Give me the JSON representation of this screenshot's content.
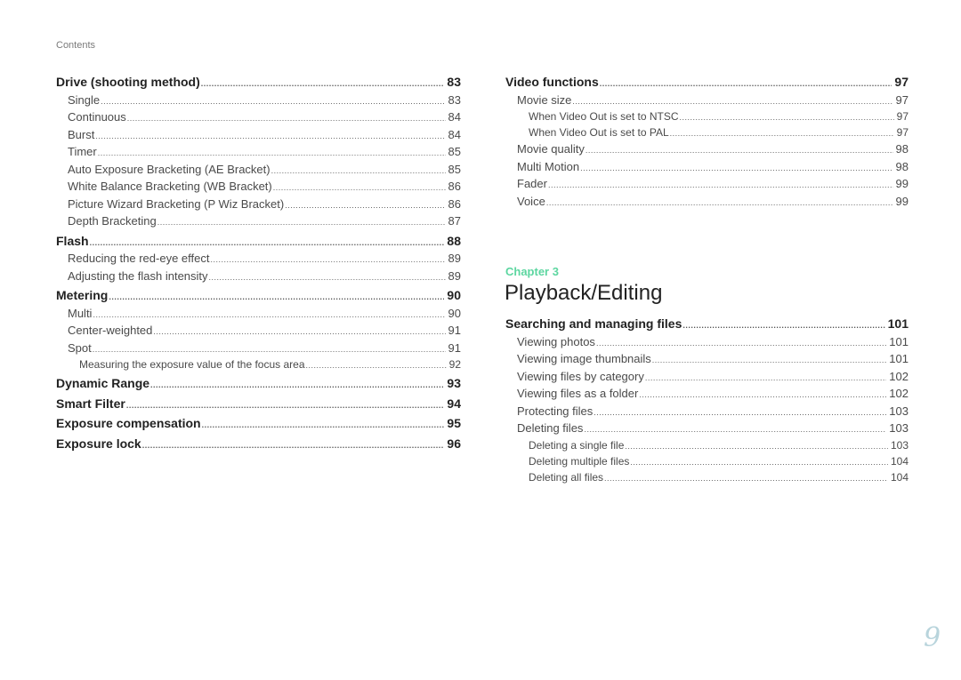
{
  "header": {
    "label": "Contents"
  },
  "left_column": [
    {
      "level": 0,
      "title": "Drive (shooting method)",
      "page": "83"
    },
    {
      "level": 1,
      "title": "Single",
      "page": "83"
    },
    {
      "level": 1,
      "title": "Continuous",
      "page": "84"
    },
    {
      "level": 1,
      "title": "Burst",
      "page": "84"
    },
    {
      "level": 1,
      "title": "Timer",
      "page": "85"
    },
    {
      "level": 1,
      "title": "Auto Exposure Bracketing (AE Bracket)",
      "page": "85"
    },
    {
      "level": 1,
      "title": "White Balance Bracketing (WB Bracket)",
      "page": "86"
    },
    {
      "level": 1,
      "title": "Picture Wizard Bracketing (P Wiz Bracket)",
      "page": "86"
    },
    {
      "level": 1,
      "title": "Depth Bracketing",
      "page": "87"
    },
    {
      "level": 0,
      "title": "Flash",
      "page": "88"
    },
    {
      "level": 1,
      "title": "Reducing the red-eye effect",
      "page": "89"
    },
    {
      "level": 1,
      "title": "Adjusting the flash intensity",
      "page": "89"
    },
    {
      "level": 0,
      "title": "Metering",
      "page": "90"
    },
    {
      "level": 1,
      "title": "Multi",
      "page": "90"
    },
    {
      "level": 1,
      "title": "Center-weighted",
      "page": "91"
    },
    {
      "level": 1,
      "title": "Spot",
      "page": "91"
    },
    {
      "level": 2,
      "title": "Measuring the exposure value of the focus area",
      "page": "92"
    },
    {
      "level": 0,
      "title": "Dynamic Range",
      "page": "93"
    },
    {
      "level": 0,
      "title": "Smart Filter",
      "page": "94"
    },
    {
      "level": 0,
      "title": "Exposure compensation",
      "page": "95"
    },
    {
      "level": 0,
      "title": "Exposure lock",
      "page": "96"
    }
  ],
  "right_column_top": [
    {
      "level": 0,
      "title": "Video functions",
      "page": "97"
    },
    {
      "level": 1,
      "title": "Movie size",
      "page": "97"
    },
    {
      "level": 2,
      "title": "When Video Out is set to NTSC",
      "page": "97"
    },
    {
      "level": 2,
      "title": "When Video Out is set to PAL",
      "page": "97"
    },
    {
      "level": 1,
      "title": "Movie quality",
      "page": "98"
    },
    {
      "level": 1,
      "title": "Multi Motion",
      "page": "98"
    },
    {
      "level": 1,
      "title": "Fader",
      "page": "99"
    },
    {
      "level": 1,
      "title": "Voice",
      "page": "99"
    }
  ],
  "chapter": {
    "label": "Chapter 3",
    "title": "Playback/Editing",
    "accent_color": "#5cd6a0"
  },
  "right_column_bottom": [
    {
      "level": 0,
      "title": "Searching and managing files",
      "page": "101"
    },
    {
      "level": 1,
      "title": "Viewing photos",
      "page": "101"
    },
    {
      "level": 1,
      "title": "Viewing image thumbnails",
      "page": "101"
    },
    {
      "level": 1,
      "title": "Viewing files by category",
      "page": "102"
    },
    {
      "level": 1,
      "title": "Viewing files as a folder",
      "page": "102"
    },
    {
      "level": 1,
      "title": "Protecting files",
      "page": "103"
    },
    {
      "level": 1,
      "title": "Deleting files",
      "page": "103"
    },
    {
      "level": 2,
      "title": "Deleting a single file",
      "page": "103"
    },
    {
      "level": 2,
      "title": "Deleting multiple files",
      "page": "104"
    },
    {
      "level": 2,
      "title": "Deleting all files",
      "page": "104"
    }
  ],
  "page_number": "9"
}
